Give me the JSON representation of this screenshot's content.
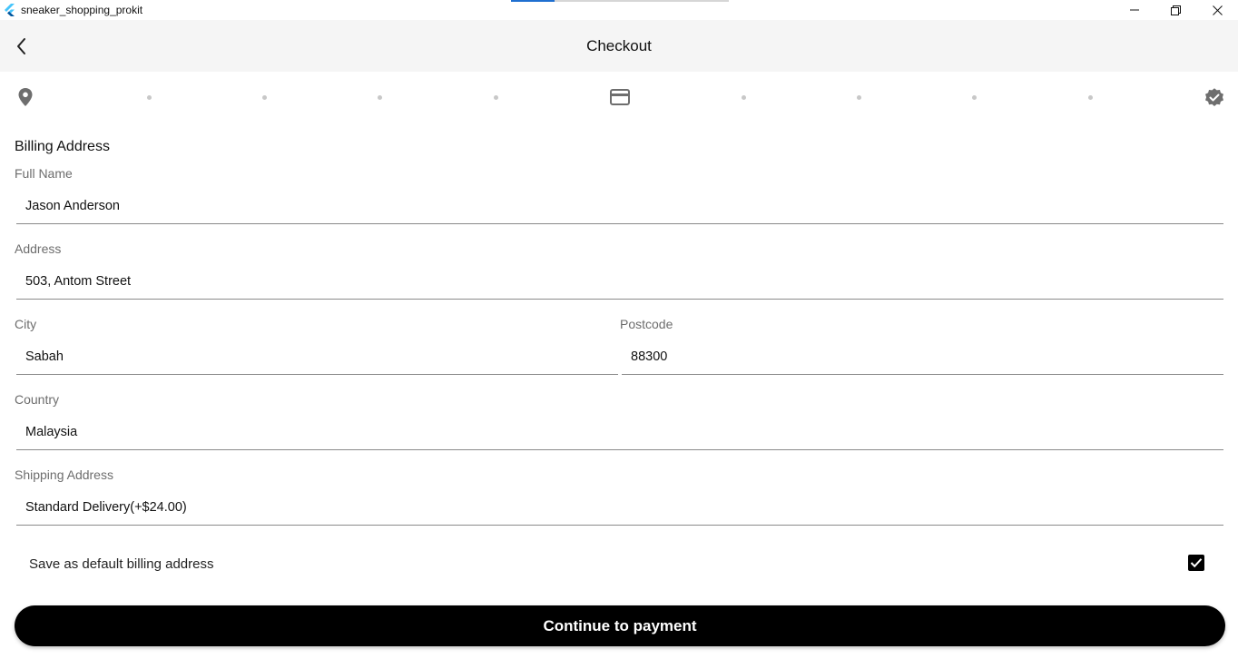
{
  "window": {
    "title": "sneaker_shopping_prokit",
    "icons": {
      "app": "flutter-icon",
      "minimize": "minimize-icon",
      "maximize": "restore-icon",
      "close": "close-icon"
    }
  },
  "appbar": {
    "title": "Checkout",
    "back_icon": "arrow-back-icon"
  },
  "stepper": {
    "steps": [
      {
        "icon": "location-pin-icon",
        "state": "complete"
      },
      {
        "icon": "credit-card-icon",
        "state": "current"
      },
      {
        "icon": "verified-badge-icon",
        "state": "pending"
      }
    ]
  },
  "billing": {
    "section_title": "Billing Address",
    "full_name": {
      "label": "Full Name",
      "value": "Jason Anderson"
    },
    "address": {
      "label": "Address",
      "value": "503, Antom Street"
    },
    "city": {
      "label": "City",
      "value": "Sabah"
    },
    "postcode": {
      "label": "Postcode",
      "value": "88300"
    },
    "country": {
      "label": "Country",
      "value": "Malaysia"
    },
    "shipping": {
      "label": "Shipping Address",
      "value": "Standard Delivery(+$24.00)"
    },
    "save_default": {
      "label": "Save as default billing address",
      "checked": true
    }
  },
  "actions": {
    "continue_label": "Continue to payment"
  },
  "colors": {
    "primary": "#000000",
    "appbar_bg": "#f5f5f5",
    "accent_blue": "#1f6fd0",
    "icon_grey": "#6e6e6e"
  }
}
